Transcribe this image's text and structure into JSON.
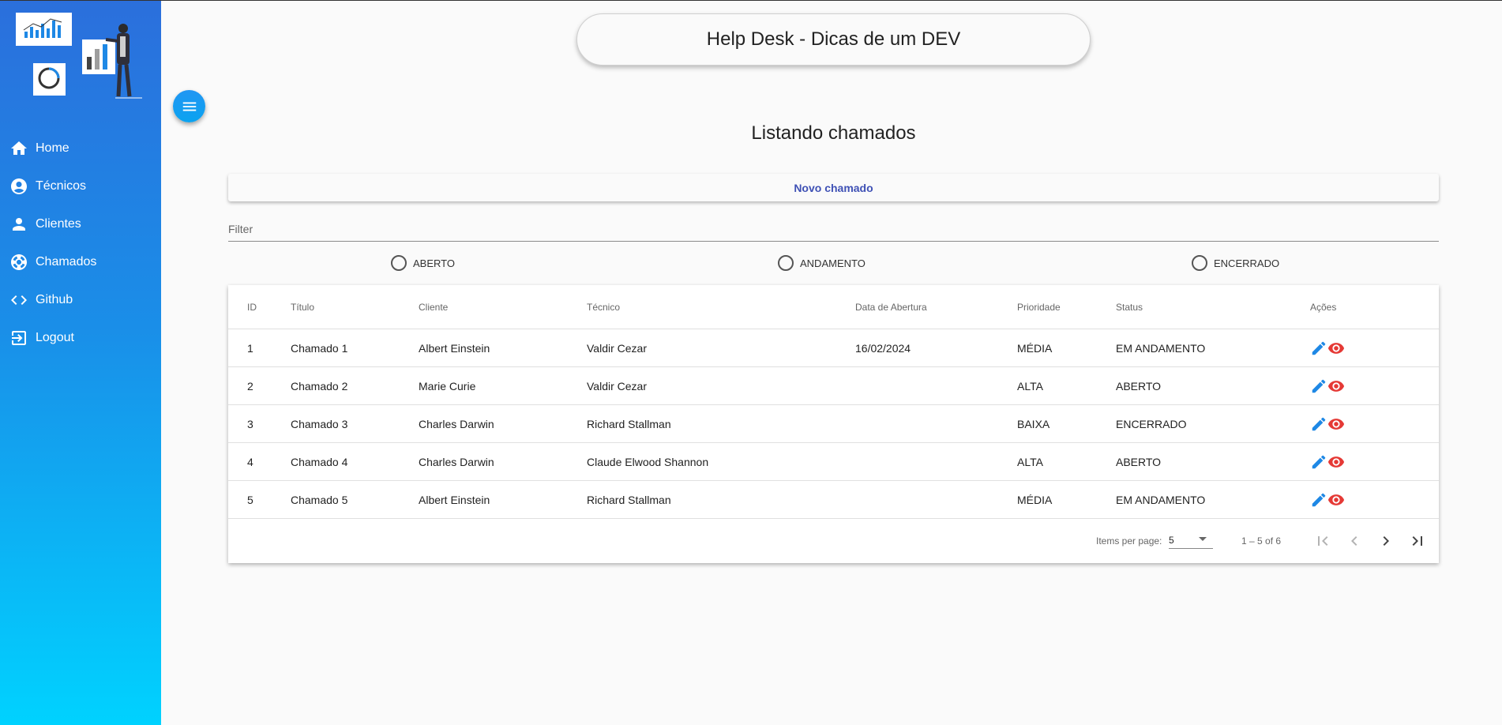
{
  "app": {
    "title": "Help Desk - Dicas de um DEV"
  },
  "sidebar": {
    "items": [
      {
        "label": "Home",
        "icon": "home-icon"
      },
      {
        "label": "Técnicos",
        "icon": "account-circle-icon"
      },
      {
        "label": "Clientes",
        "icon": "person-icon"
      },
      {
        "label": "Chamados",
        "icon": "support-icon"
      },
      {
        "label": "Github",
        "icon": "code-icon"
      },
      {
        "label": "Logout",
        "icon": "logout-icon"
      }
    ]
  },
  "main": {
    "title": "Listando chamados",
    "new_button": "Novo chamado",
    "filter_placeholder": "Filter",
    "radios": [
      "ABERTO",
      "ANDAMENTO",
      "ENCERRADO"
    ]
  },
  "table": {
    "columns": [
      "ID",
      "Título",
      "Cliente",
      "Técnico",
      "Data de Abertura",
      "Prioridade",
      "Status",
      "Ações"
    ],
    "rows": [
      [
        "1",
        "Chamado 1",
        "Albert Einstein",
        "Valdir Cezar",
        "16/02/2024",
        "MÉDIA",
        "EM ANDAMENTO"
      ],
      [
        "2",
        "Chamado 2",
        "Marie Curie",
        "Valdir Cezar",
        "",
        "ALTA",
        "ABERTO"
      ],
      [
        "3",
        "Chamado 3",
        "Charles Darwin",
        "Richard Stallman",
        "",
        "BAIXA",
        "ENCERRADO"
      ],
      [
        "4",
        "Chamado 4",
        "Charles Darwin",
        "Claude Elwood Shannon",
        "",
        "ALTA",
        "ABERTO"
      ],
      [
        "5",
        "Chamado 5",
        "Albert Einstein",
        "Richard Stallman",
        "",
        "MÉDIA",
        "EM ANDAMENTO"
      ]
    ]
  },
  "paginator": {
    "items_label": "Items per page:",
    "page_size": "5",
    "range": "1 – 5 of 6"
  },
  "colors": {
    "accent": "#3f51b5",
    "edit": "#1e88e5",
    "view": "#e53935",
    "sidebar_top": "#2b6fdc",
    "sidebar_bottom": "#00d2ff"
  }
}
